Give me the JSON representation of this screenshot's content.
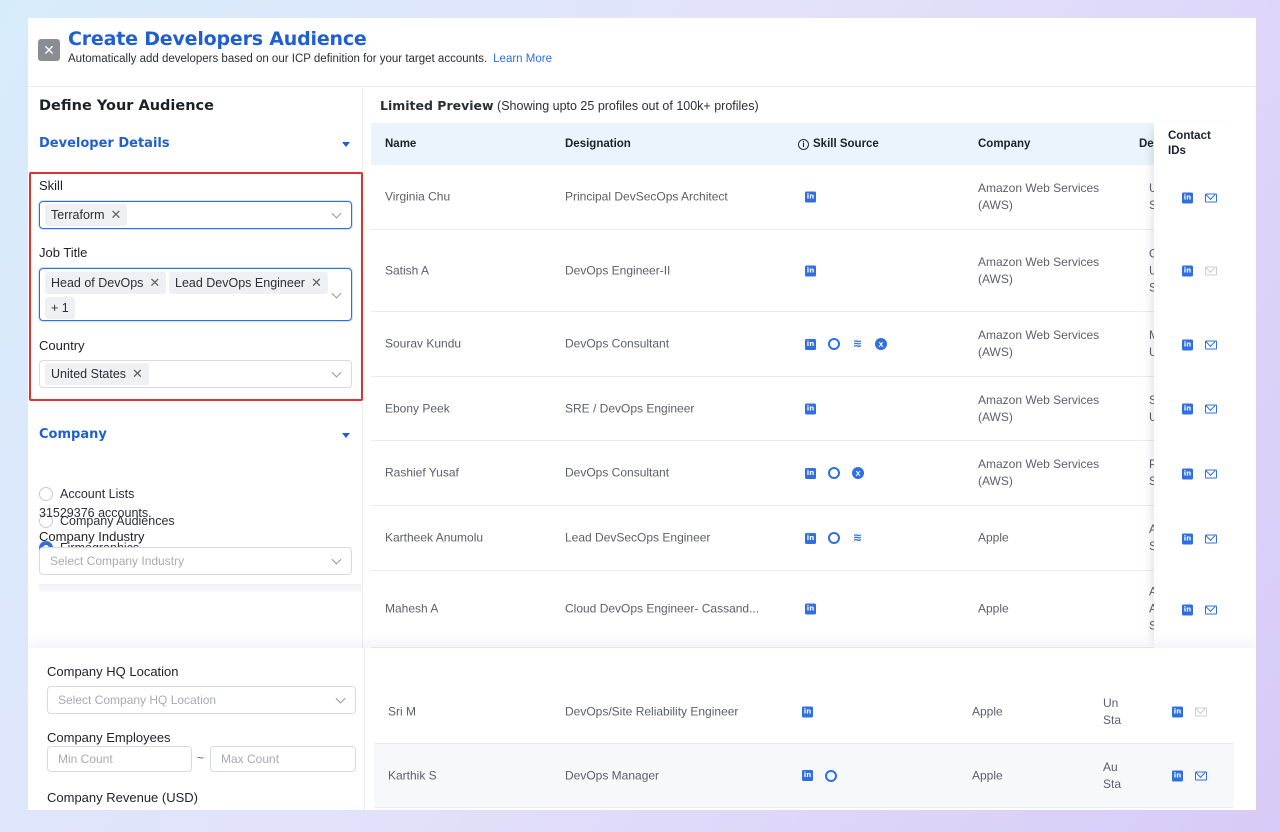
{
  "header": {
    "title": "Create Developers Audience",
    "subtitle": "Automatically add developers based on our ICP definition for your target accounts.",
    "learn_more": "Learn More",
    "close_glyph": "✕"
  },
  "left": {
    "define_title": "Define Your Audience",
    "developer_details": "Developer Details",
    "skill": {
      "label": "Skill",
      "tags": [
        "Terraform"
      ]
    },
    "job_title": {
      "label": "Job Title",
      "tags": [
        "Head of DevOps",
        "Lead DevOps Engineer"
      ],
      "more": "+ 1"
    },
    "country": {
      "label": "Country",
      "tags": [
        "United States"
      ]
    },
    "company": "Company",
    "radios": [
      {
        "label": "Account Lists",
        "selected": false
      },
      {
        "label": "Company Audiences",
        "selected": false
      },
      {
        "label": "Firmographics",
        "selected": true
      }
    ],
    "accounts": "31529376 accounts.",
    "industry": {
      "label": "Company Industry",
      "placeholder": "Select Company Industry"
    },
    "hq": {
      "label": "Company HQ Location",
      "placeholder": "Select Company HQ Location"
    },
    "employees": {
      "label": "Company Employees",
      "min": "Min Count",
      "sep": "~",
      "max": "Max Count"
    },
    "revenue": {
      "label": "Company Revenue (USD)"
    },
    "tag_remove": "✕"
  },
  "preview": {
    "title_bold": "Limited Preview",
    "title_rest": " (Showing upto 25 profiles out of 100k+ profiles)",
    "columns": [
      "Name",
      "Designation",
      "Skill Source",
      "Company",
      "De",
      "Contact IDs"
    ],
    "info_glyph": "i",
    "icon_glyphs": {
      "linkedin": "in",
      "stackoverflow": "≋",
      "twitter": "X"
    }
  },
  "rows": [
    {
      "name": "Virginia Chu",
      "designation": "Principal DevSecOps Architect",
      "company": "Amazon Web Services (AWS)",
      "dept": [
        "Un",
        "Sta"
      ],
      "sources": [
        "linkedin"
      ],
      "mail": true
    },
    {
      "name": "Satish A",
      "designation": "DevOps Engineer-II",
      "company": "Amazon Web Services (AWS)",
      "dept": [
        "Gr",
        "Un",
        "Sta"
      ],
      "sources": [
        "linkedin"
      ],
      "mail": false
    },
    {
      "name": "Sourav Kundu",
      "designation": "DevOps Consultant",
      "company": "Amazon Web Services (AWS)",
      "dept": [
        "Mi",
        "Un"
      ],
      "sources": [
        "linkedin",
        "github",
        "stackoverflow",
        "twitter"
      ],
      "mail": true
    },
    {
      "name": "Ebony Peek",
      "designation": "SRE / DevOps Engineer",
      "company": "Amazon Web Services (AWS)",
      "dept": [
        "Se",
        "Un"
      ],
      "sources": [
        "linkedin"
      ],
      "mail": true
    },
    {
      "name": "Rashief Yusaf",
      "designation": "DevOps Consultant",
      "company": "Amazon Web Services (AWS)",
      "dept": [
        "Pe",
        "Sta"
      ],
      "sources": [
        "linkedin",
        "github",
        "twitter"
      ],
      "mail": true
    },
    {
      "name": "Kartheek Anumolu",
      "designation": "Lead DevSecOps Engineer",
      "company": "Apple",
      "dept": [
        "Au",
        "Sta"
      ],
      "sources": [
        "linkedin",
        "github",
        "stackoverflow"
      ],
      "mail": true
    },
    {
      "name": "Mahesh A",
      "designation": "Cloud DevOps Engineer- Cassand...",
      "company": "Apple",
      "dept": [
        "Au",
        "Are",
        "Sta"
      ],
      "sources": [
        "linkedin"
      ],
      "mail": true
    }
  ],
  "lower_rows": [
    {
      "name": "Sri M",
      "designation": "DevOps/Site Reliability Engineer",
      "company": "Apple",
      "dept": [
        "Un",
        "Sta"
      ],
      "sources": [
        "linkedin"
      ],
      "mail": false
    },
    {
      "name": "Karthik S",
      "designation": "DevOps Manager",
      "company": "Apple",
      "dept": [
        "Au",
        "Sta"
      ],
      "sources": [
        "linkedin",
        "github"
      ],
      "mail": true
    }
  ]
}
